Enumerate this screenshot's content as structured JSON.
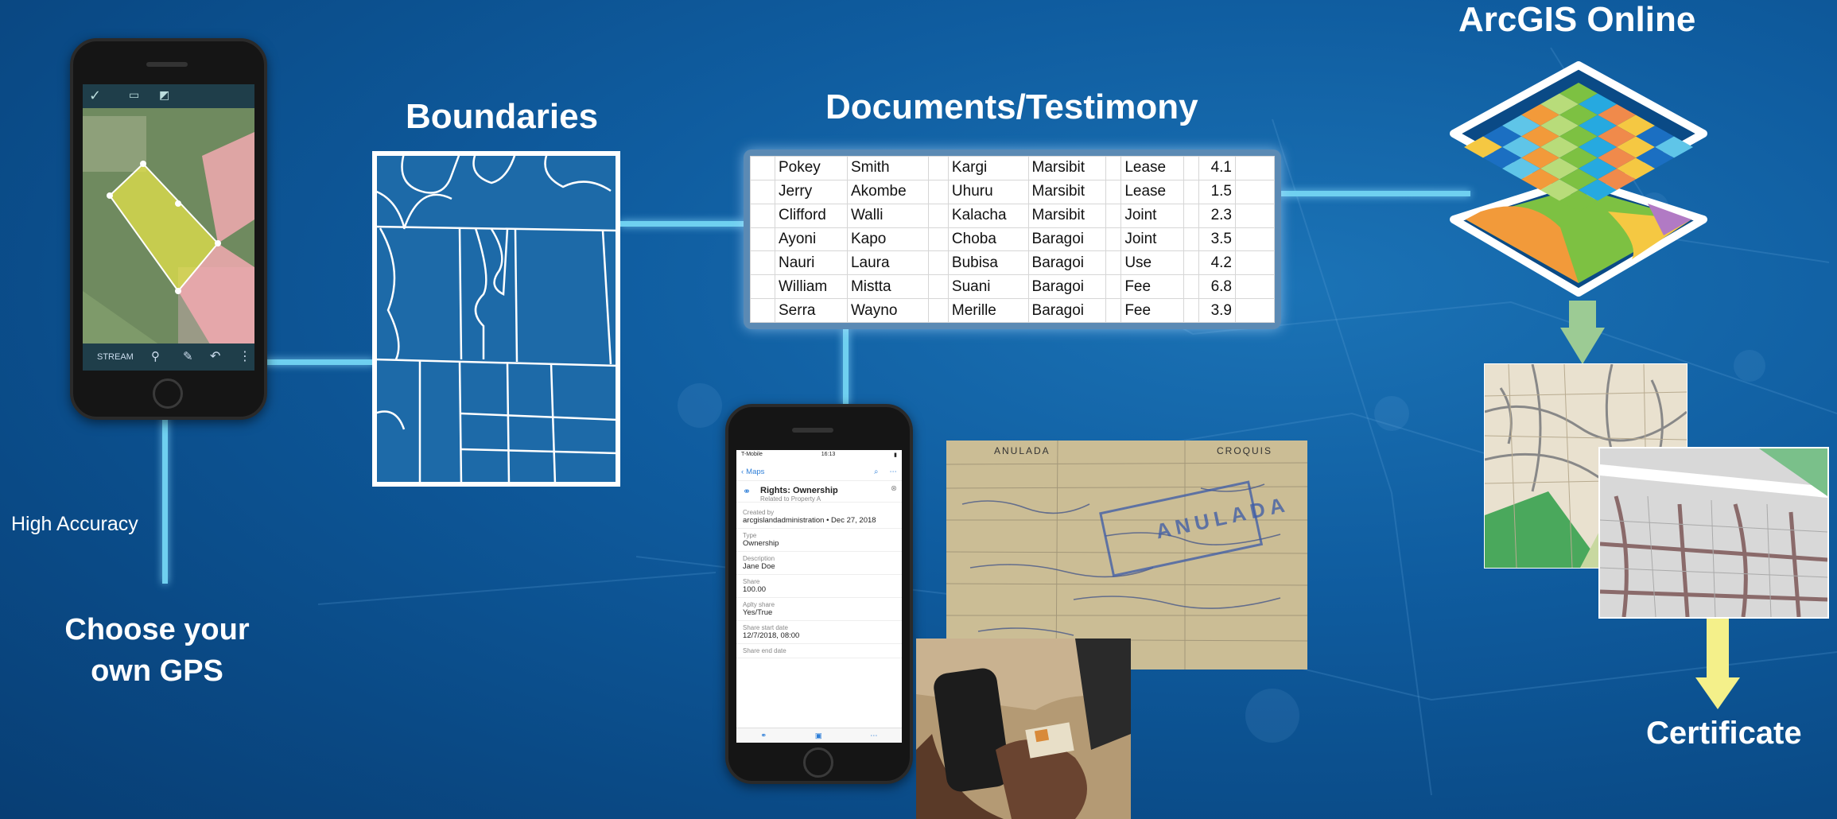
{
  "titles": {
    "arcgis": "ArcGIS Online",
    "boundaries": "Boundaries",
    "documents": "Documents/Testimony",
    "certificate": "Certificate",
    "gps_line1": "Choose your",
    "gps_line2": "own GPS",
    "accuracy": "High Accuracy"
  },
  "table": {
    "rows": [
      [
        "Pokey",
        "Smith",
        "Kargi",
        "Marsibit",
        "Lease",
        "4.1"
      ],
      [
        "Jerry",
        "Akombe",
        "Uhuru",
        "Marsibit",
        "Lease",
        "1.5"
      ],
      [
        "Clifford",
        "Walli",
        "Kalacha",
        "Marsibit",
        "Joint",
        "2.3"
      ],
      [
        "Ayoni",
        "Kapo",
        "Choba",
        "Baragoi",
        "Joint",
        "3.5"
      ],
      [
        "Nauri",
        "Laura",
        "Bubisa",
        "Baragoi",
        "Use",
        "4.2"
      ],
      [
        "William",
        "Mistta",
        "Suani",
        "Baragoi",
        "Fee",
        "6.8"
      ],
      [
        "Serra",
        "Wayno",
        "Merille",
        "Baragoi",
        "Fee",
        "3.9"
      ]
    ]
  },
  "collector_phone": {
    "toolbar_label": "STREAM"
  },
  "survey_phone": {
    "carrier": "T-Mobile",
    "time": "16:13",
    "back_label": "Maps",
    "card_title": "Rights: Ownership",
    "card_subtitle": "Related to Property A",
    "created_by_label": "Created by",
    "created_by_value": "arcgislandadministration • Dec 27, 2018",
    "fields": [
      {
        "label": "Type",
        "value": "Ownership"
      },
      {
        "label": "Description",
        "value": "Jane Doe"
      },
      {
        "label": "Share",
        "value": "100.00"
      },
      {
        "label": "Aplty share",
        "value": "Yes/True"
      },
      {
        "label": "Share start date",
        "value": "12/7/2018, 08:00"
      },
      {
        "label": "Share end date",
        "value": ""
      }
    ]
  },
  "deed_text": {
    "header_left": "ANULADA",
    "header_right": "CROQUIS",
    "stamp": "ANULADA"
  },
  "colors": {
    "connector": "#6fd0f0",
    "arrow_green": "#9ccb94",
    "arrow_yellow": "#f4f08a",
    "parcel_yellow": "#e3e24a",
    "parcel_pink": "#f2a9b0"
  }
}
